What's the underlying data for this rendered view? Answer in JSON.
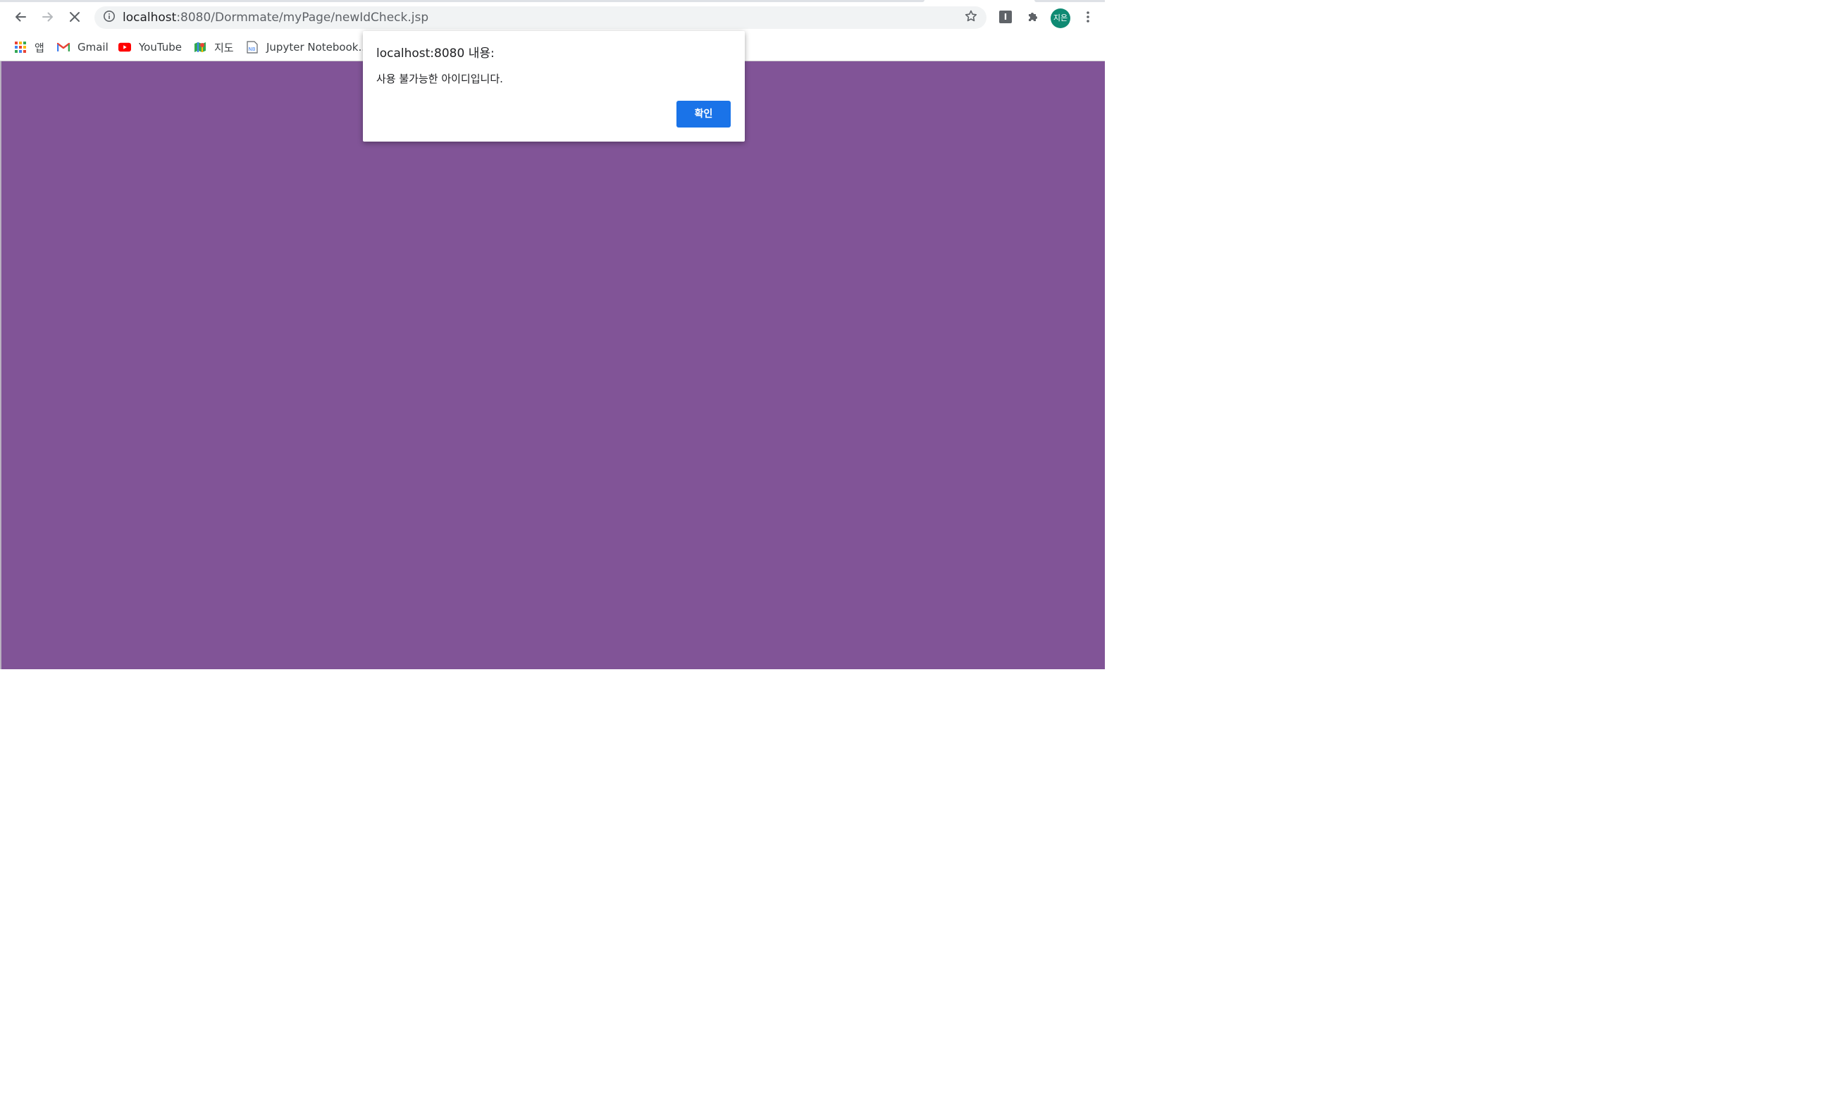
{
  "browser": {
    "address_bar": {
      "host": "localhost",
      "path": ":8080/Dormmate/myPage/newIdCheck.jsp"
    },
    "profile": {
      "initials": "지은",
      "color": "#0f8a73"
    },
    "extension_label": "I"
  },
  "bookmarks": [
    {
      "label": "앱",
      "icon": "apps-grid-icon"
    },
    {
      "label": "Gmail",
      "icon": "gmail-icon"
    },
    {
      "label": "YouTube",
      "icon": "youtube-icon"
    },
    {
      "label": "지도",
      "icon": "maps-icon"
    },
    {
      "label": "Jupyter Notebook...",
      "icon": "notebook-icon"
    }
  ],
  "page": {
    "background": "#815497"
  },
  "dialog": {
    "title": "localhost:8080 내용:",
    "message": "사용 불가능한 아이디입니다.",
    "ok_label": "확인",
    "button_color": "#1a73e8"
  }
}
